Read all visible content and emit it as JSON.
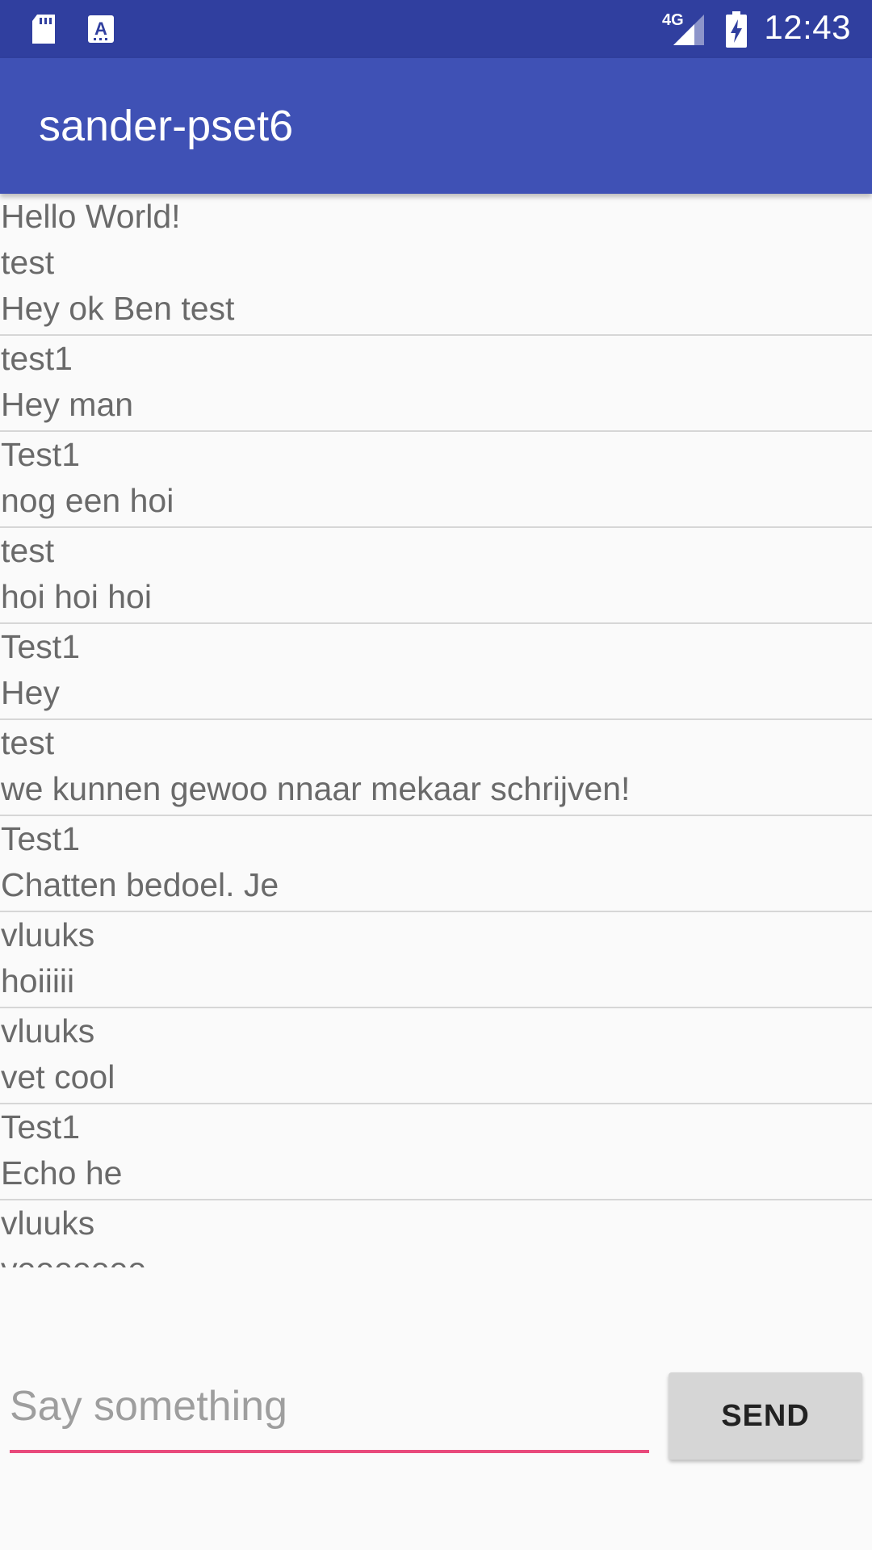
{
  "status_bar": {
    "network": "4G",
    "time": "12:43",
    "icons": [
      "sd-card-icon",
      "keyboard-a-icon",
      "signal-icon",
      "battery-charging-icon"
    ]
  },
  "app_bar": {
    "title": "sander-pset6"
  },
  "messages": [
    {
      "lines": [
        "Hello World!",
        "test",
        "Hey ok Ben test"
      ]
    },
    {
      "lines": [
        "test1",
        "Hey man"
      ]
    },
    {
      "lines": [
        "Test1",
        "nog een hoi"
      ]
    },
    {
      "lines": [
        "test",
        "hoi hoi hoi"
      ]
    },
    {
      "lines": [
        "Test1",
        "Hey"
      ]
    },
    {
      "lines": [
        "test",
        "we kunnen gewoo nnaar mekaar schrijven!"
      ]
    },
    {
      "lines": [
        "Test1",
        "Chatten bedoel. Je"
      ]
    },
    {
      "lines": [
        "vluuks",
        "hoiiiii"
      ]
    },
    {
      "lines": [
        "vluuks",
        "vet cool"
      ]
    },
    {
      "lines": [
        "Test1",
        "Echo he"
      ]
    },
    {
      "lines": [
        "vluuks",
        "yeeeeeee"
      ]
    }
  ],
  "composer": {
    "input_value": "",
    "input_placeholder": "Say something",
    "send_label": "SEND",
    "accent_color": "#e84a7c"
  },
  "colors": {
    "status_bar": "#303f9f",
    "app_bar": "#3f51b5",
    "background": "#fafafa"
  }
}
